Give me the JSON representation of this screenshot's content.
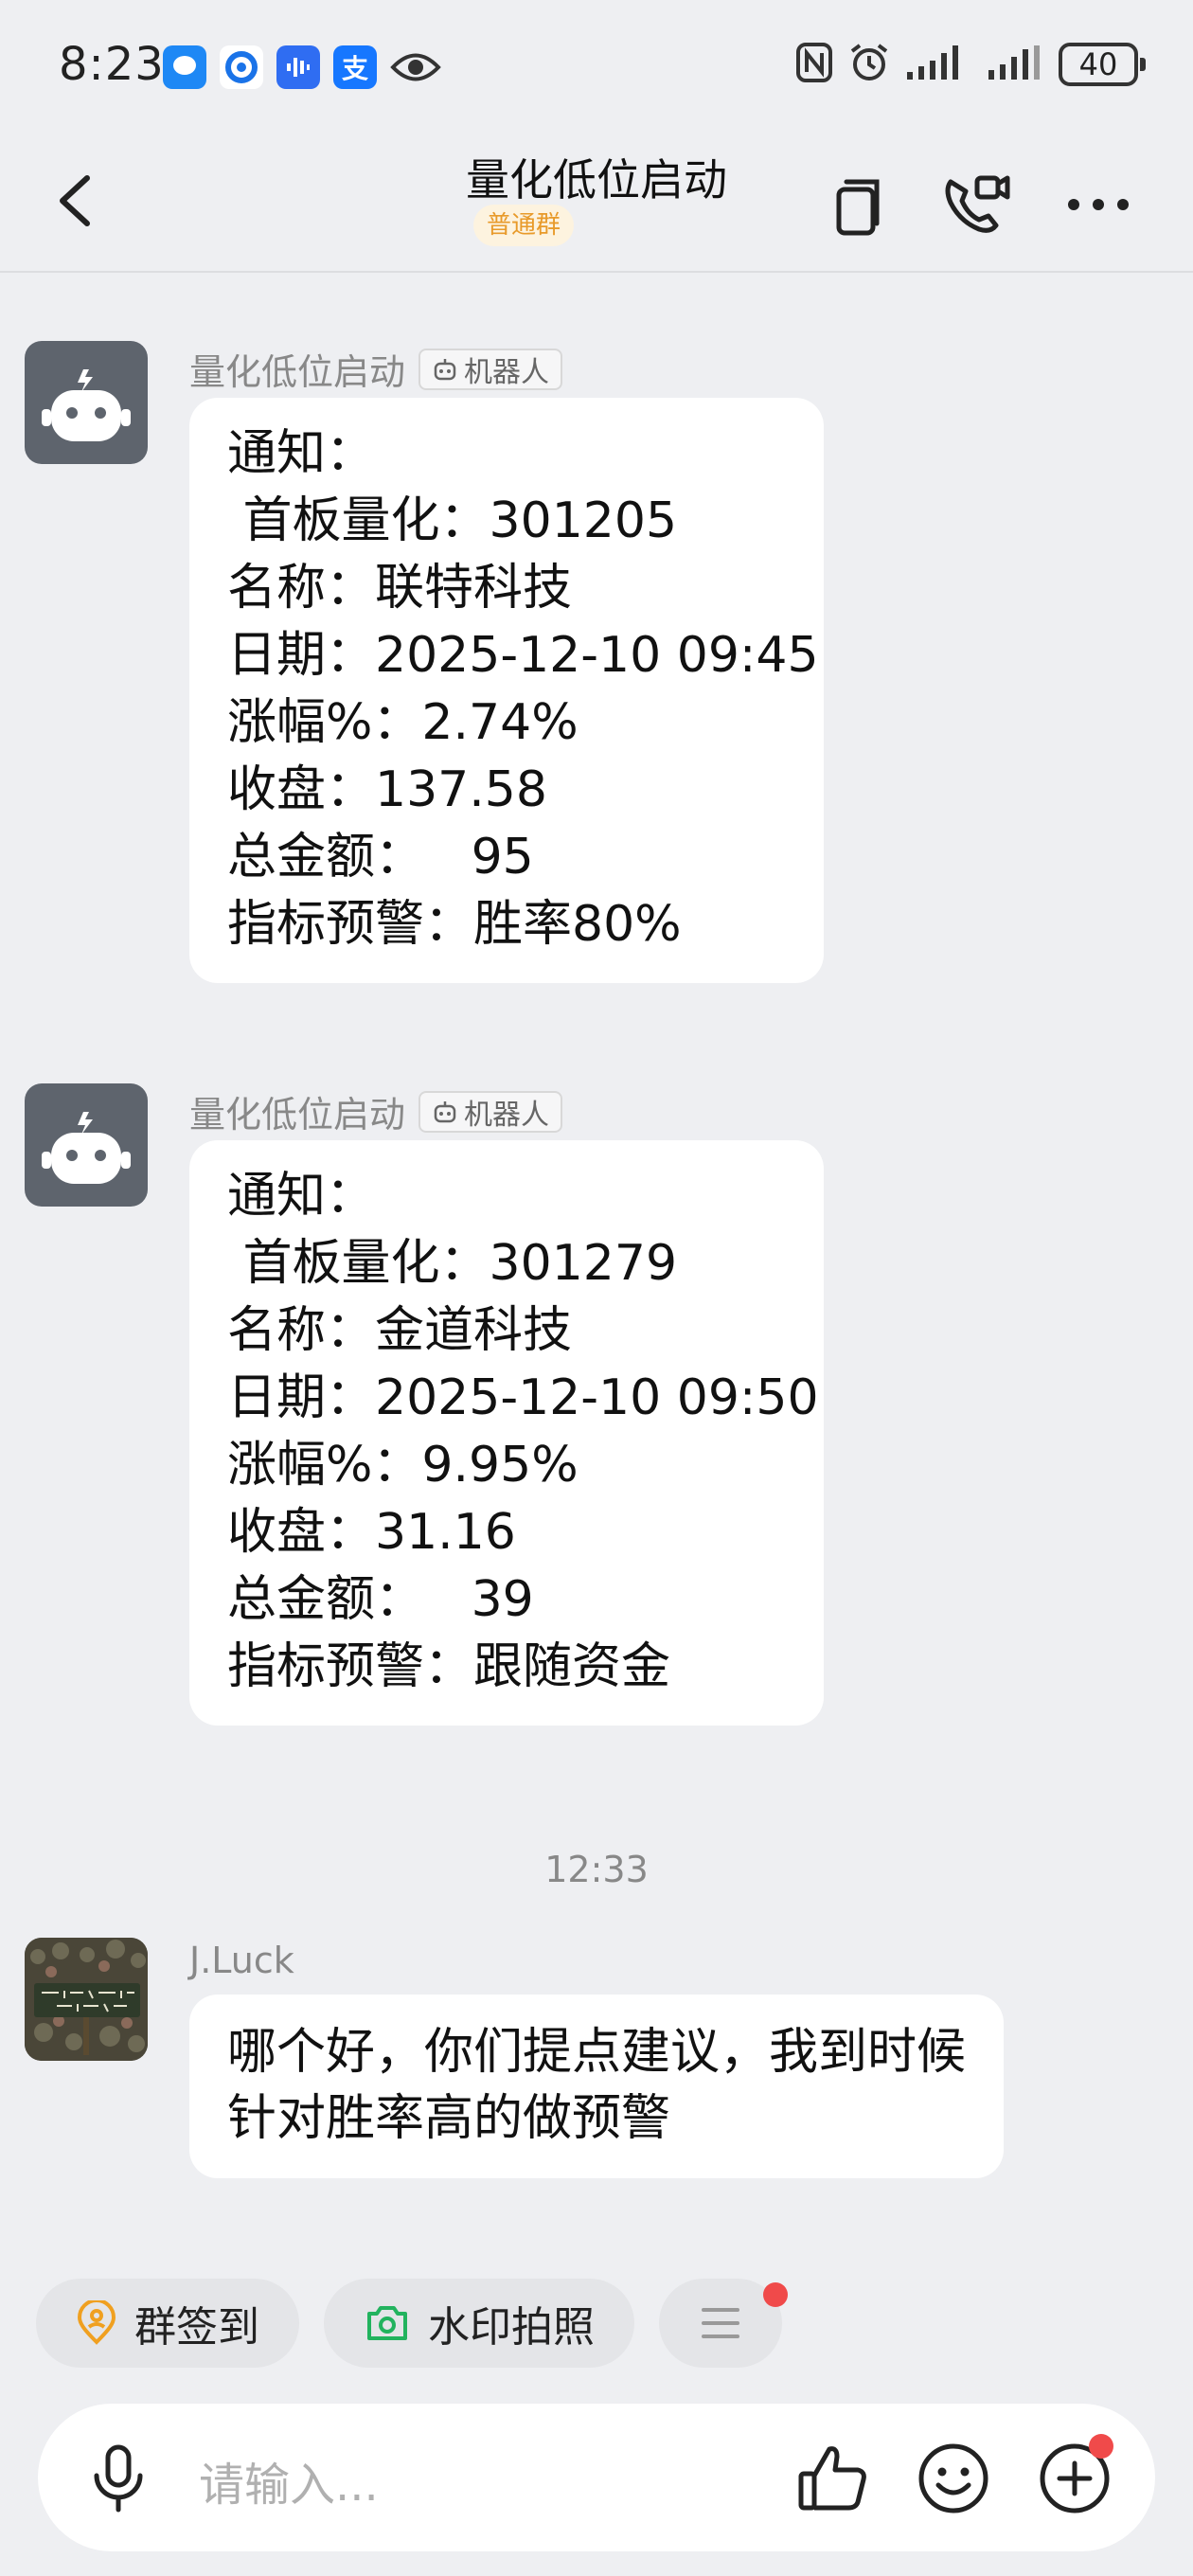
{
  "status_bar": {
    "time": "8:23",
    "battery": "40",
    "apps": [
      {
        "name": "message-app-icon",
        "glyph": "●",
        "color": "#1e88f5"
      },
      {
        "name": "browser-app-icon",
        "glyph": "◐",
        "color": "#1a73e8"
      },
      {
        "name": "audio-app-icon",
        "glyph": "▮",
        "color": "#2f6df2"
      },
      {
        "name": "alipay-app-icon",
        "glyph": "支",
        "color": "#1677ff"
      }
    ]
  },
  "header": {
    "title": "量化低位启动",
    "tag": "普通群"
  },
  "messages": [
    {
      "sender": "量化低位启动",
      "robot_tag": "机器人",
      "lines": [
        "通知：",
        " 首板量化：301205",
        "名称：联特科技",
        "日期：2025-12-10 09:45",
        "涨幅%：2.74%",
        "收盘：137.58",
        "总金额：   95",
        "指标预警：胜率80%"
      ]
    },
    {
      "sender": "量化低位启动",
      "robot_tag": "机器人",
      "lines": [
        "通知：",
        " 首板量化：301279",
        "名称：金道科技",
        "日期：2025-12-10 09:50",
        "涨幅%：9.95%",
        "收盘：31.16",
        "总金额：   39",
        "指标预警：跟随资金"
      ]
    }
  ],
  "timestamp": "12:33",
  "user_message": {
    "sender": "J.Luck",
    "lines": [
      "哪个好，你们提点建议，我到时候",
      "针对胜率高的做预警"
    ]
  },
  "quick_actions": {
    "checkin": "群签到",
    "watermark_photo": "水印拍照"
  },
  "input": {
    "placeholder": "请输入..."
  },
  "colors": {
    "background": "#eeeff2",
    "bubble": "#ffffff",
    "bot_avatar": "#5e646d",
    "tag_text": "#e89a2a",
    "checkin_icon": "#f0a020",
    "camera_icon": "#22b35e",
    "badge_red": "#f04a4a"
  }
}
